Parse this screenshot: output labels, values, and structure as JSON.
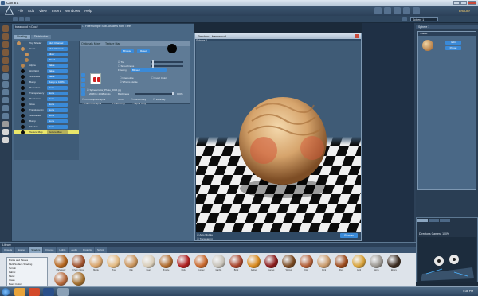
{
  "app": {
    "title": "Carrara"
  },
  "menu": [
    "File",
    "Edit",
    "View",
    "Insert",
    "Windows",
    "Help"
  ],
  "room": {
    "current": "Texture",
    "other": "Assemble"
  },
  "toolstrip": {
    "object_field": "Sphere 1"
  },
  "material_panel": {
    "shader_path": "basswood in Doc2",
    "filter_option": "Filter Simple Sub-Shaders from Tree",
    "tabs": [
      "Shading",
      "Distribution"
    ],
    "tree_rows": [
      {
        "label": "Top Shader",
        "value": "Multi Channel"
      },
      {
        "label": "Color",
        "value": "Multi Channel"
      },
      {
        "label": "",
        "value": "Mixer"
      },
      {
        "label": "",
        "value": "Wood"
      },
      {
        "label": "Alpha",
        "value": "Value"
      },
      {
        "label": "Highlight",
        "value": "Value"
      },
      {
        "label": "Shininess",
        "value": "Value"
      },
      {
        "label": "Bump",
        "value": "Bump to 100%"
      },
      {
        "label": "Reflection",
        "value": "None"
      },
      {
        "label": "Transparency",
        "value": "None"
      },
      {
        "label": "Refraction",
        "value": "None"
      },
      {
        "label": "Glow",
        "value": "None"
      },
      {
        "label": "Translucency",
        "value": "None"
      },
      {
        "label": "Subsurface",
        "value": "None"
      },
      {
        "label": "Bump",
        "value": "None"
      },
      {
        "label": "Shadow",
        "value": "None"
      },
      {
        "label": "Texture Map",
        "value": "Texture Map"
      }
    ],
    "node": {
      "header_left": "Optionals Mixer",
      "header_right": "Texture Map",
      "browse_label": "Browse",
      "reset_label": "Reset",
      "tile_label": "Tile",
      "smoothness_label": "Smoothness",
      "filtering_label": "Filtering",
      "filtering_value": "Bilinear",
      "file_name": "SphereColor_Photo_0036.jpg",
      "resolution": "2048 by 2048 pixels",
      "brightness_label": "Brightness",
      "brightness_value": "100%",
      "checks": [
        "Interpolate",
        "Invert Color",
        "What is visible",
        "Premultiplied Alpha",
        "Color And Alpha",
        "Color Only",
        "Alpha Only",
        "Horizontally",
        "Vertically"
      ],
      "mirror_label": "Mirror"
    }
  },
  "preview": {
    "title": "Preview - basswood",
    "object": "Sphere 1",
    "auto_update": "Auto Update",
    "transparent": "Transparent",
    "render_label": "Render"
  },
  "right_panel": {
    "header": "Sphere 1",
    "box_title": "Shader",
    "edit_label": "Edit",
    "preset_label": "Preset"
  },
  "camera": {
    "title": "Director's Camera 100%"
  },
  "library": {
    "title": "Library",
    "tabs": [
      "Objects",
      "Scenes",
      "Shaders",
      "Figures",
      "Lights",
      "Audio",
      "Projects",
      "Scripts"
    ],
    "active_tab": "Shaders",
    "categories": [
      "Bricks and Stones",
      "Multi Surface Shading",
      "Terrain",
      "Fabric",
      "Metal",
      "Glass",
      "Basic Colors"
    ],
    "thumbs": [
      {
        "label": "Mahogany",
        "color": "#b5651d"
      },
      {
        "label": "Cherry Wood",
        "color": "#a0522d"
      },
      {
        "label": "Maple",
        "color": "#d9a46a"
      },
      {
        "label": "Pine",
        "color": "#e3b980"
      },
      {
        "label": "Oak",
        "color": "#c9935a"
      },
      {
        "label": "Pearl",
        "color": "#d9cdb8"
      },
      {
        "label": "Bronze",
        "color": "#b06b2e"
      },
      {
        "label": "Ruby",
        "color": "#b01e1e"
      },
      {
        "label": "Copper",
        "color": "#c8672b"
      },
      {
        "label": "Marble",
        "color": "#c7c2b8"
      },
      {
        "label": "Brick",
        "color": "#a8432a"
      },
      {
        "label": "Amber",
        "color": "#d98a1e"
      },
      {
        "label": "Garnet",
        "color": "#8a1a1a"
      },
      {
        "label": "Walnut",
        "color": "#7a4a22"
      },
      {
        "label": "Clay",
        "color": "#b25d35"
      },
      {
        "label": "Cork",
        "color": "#c99a6b"
      },
      {
        "label": "Rust",
        "color": "#9c4a1c"
      },
      {
        "label": "Gold",
        "color": "#d8a23a"
      },
      {
        "label": "Stone",
        "color": "#9a9690"
      },
      {
        "label": "Ebony",
        "color": "#3a2a1e"
      },
      {
        "label": "Cedar",
        "color": "#b86a3c"
      },
      {
        "label": "Teak",
        "color": "#a4702f"
      }
    ]
  },
  "taskbar": {
    "clock": "4:36 PM"
  },
  "colors": {
    "accent": "#3a8ad8",
    "selected_row": "#e9e66a",
    "panel": "#496784"
  }
}
